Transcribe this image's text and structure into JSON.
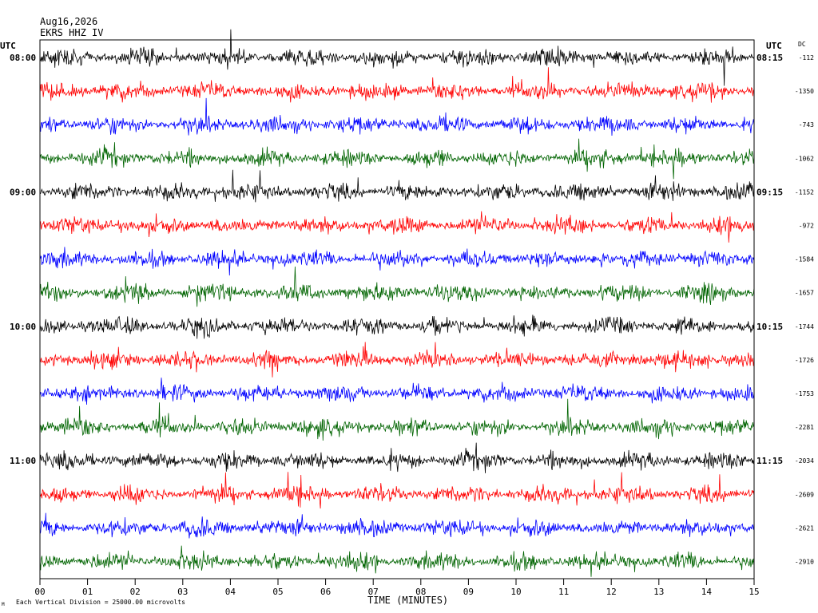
{
  "header": {
    "date": "Aug16,2026",
    "station": "EKRS HHZ IV",
    "utc_left": "UTC",
    "utc_right": "UTC",
    "dc_label": "DC"
  },
  "footer": {
    "x_axis_label": "TIME (MINUTES)",
    "scale_note": "Each Vertical Division = 25000.00 microvolts",
    "corner_mark": "M"
  },
  "chart_data": {
    "type": "line",
    "title": "",
    "xlabel": "TIME (MINUTES)",
    "ylabel": "",
    "xlim": [
      0,
      15
    ],
    "x_ticks": [
      "00",
      "01",
      "02",
      "03",
      "04",
      "05",
      "06",
      "07",
      "08",
      "09",
      "10",
      "11",
      "12",
      "13",
      "14",
      "15"
    ],
    "left_hour_labels": [
      "08:00",
      "09:00",
      "10:00",
      "11:00"
    ],
    "right_hour_labels": [
      "08:15",
      "09:15",
      "10:15",
      "11:15"
    ],
    "dc_offsets": [
      "-112",
      "-1350",
      "-743",
      "-1062",
      "-1152",
      "-972",
      "-1584",
      "-1657",
      "-1744",
      "-1726",
      "-1753",
      "-2281",
      "-2034",
      "-2609",
      "-2621",
      "-2910"
    ],
    "trace_colors": [
      "#000000",
      "#ff0000",
      "#0000ff",
      "#006400"
    ],
    "trace_count": 16,
    "minutes_per_trace": 15,
    "grid": false,
    "legend": "none",
    "notes_note": "seismogram helicorder: each row is a 15-minute segment, colors cycle black/red/blue/green"
  }
}
